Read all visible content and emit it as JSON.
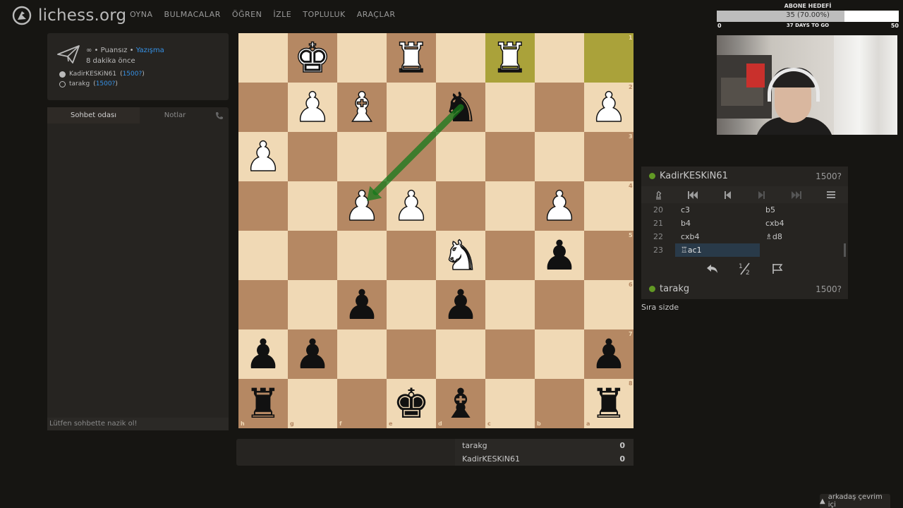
{
  "header": {
    "logo_text": "lichess.org",
    "nav": [
      "OYNA",
      "BULMACALAR",
      "ÖĞREN",
      "İZLE",
      "TOPLULUK",
      "ARAÇLAR"
    ]
  },
  "subscriber_goal": {
    "title": "ABONE HEDEFİ",
    "progress_text": "35 (70.00%)",
    "progress_fraction": 0.7,
    "min": "0",
    "max": "50",
    "days_left": "37 DAYS TO GO"
  },
  "game_info": {
    "line1_prefix": "∞ • Puansız •",
    "line1_link": "Yazışma",
    "line2": "8 dakika önce",
    "white_player": "KadirKESKiN61",
    "white_rating": "1500?",
    "black_player": "tarakg",
    "black_rating": "1500?"
  },
  "chat": {
    "tab_chat": "Sohbet odası",
    "tab_notes": "Notlar",
    "input_placeholder": "Lütfen sohbette nazik ol!"
  },
  "board": {
    "files": [
      "h",
      "g",
      "f",
      "e",
      "d",
      "c",
      "b",
      "a"
    ],
    "ranks": [
      "1",
      "2",
      "3",
      "4",
      "5",
      "6",
      "7",
      "8"
    ],
    "last_move_squares": [
      "c1",
      "a1"
    ],
    "arrow": {
      "from": "d2",
      "to": "f4",
      "color": "#15781b"
    },
    "pieces": [
      {
        "sq": "g1",
        "glyph": "♚",
        "color": "white",
        "name": "white-king"
      },
      {
        "sq": "e1",
        "glyph": "♜",
        "color": "white",
        "name": "white-rook"
      },
      {
        "sq": "c1",
        "glyph": "♜",
        "color": "white",
        "name": "white-rook"
      },
      {
        "sq": "g2",
        "glyph": "♟",
        "color": "white",
        "name": "white-pawn"
      },
      {
        "sq": "f2",
        "glyph": "♝",
        "color": "white",
        "name": "white-bishop"
      },
      {
        "sq": "d2",
        "glyph": "♞",
        "color": "black",
        "name": "black-knight"
      },
      {
        "sq": "a2",
        "glyph": "♟",
        "color": "white",
        "name": "white-pawn"
      },
      {
        "sq": "h3",
        "glyph": "♟",
        "color": "white",
        "name": "white-pawn"
      },
      {
        "sq": "f4",
        "glyph": "♟",
        "color": "white",
        "name": "white-pawn"
      },
      {
        "sq": "e4",
        "glyph": "♟",
        "color": "white",
        "name": "white-pawn"
      },
      {
        "sq": "b4",
        "glyph": "♟",
        "color": "white",
        "name": "white-pawn"
      },
      {
        "sq": "d5",
        "glyph": "♞",
        "color": "white",
        "name": "white-knight"
      },
      {
        "sq": "b5",
        "glyph": "♟",
        "color": "black",
        "name": "black-pawn"
      },
      {
        "sq": "f6",
        "glyph": "♟",
        "color": "black",
        "name": "black-pawn"
      },
      {
        "sq": "d6",
        "glyph": "♟",
        "color": "black",
        "name": "black-pawn"
      },
      {
        "sq": "h7",
        "glyph": "♟",
        "color": "black",
        "name": "black-pawn"
      },
      {
        "sq": "g7",
        "glyph": "♟",
        "color": "black",
        "name": "black-pawn"
      },
      {
        "sq": "a7",
        "glyph": "♟",
        "color": "black",
        "name": "black-pawn"
      },
      {
        "sq": "h8",
        "glyph": "♜",
        "color": "black",
        "name": "black-rook"
      },
      {
        "sq": "e8",
        "glyph": "♚",
        "color": "black",
        "name": "black-king"
      },
      {
        "sq": "d8",
        "glyph": "♝",
        "color": "black",
        "name": "black-bishop"
      },
      {
        "sq": "a8",
        "glyph": "♜",
        "color": "black",
        "name": "black-rook"
      }
    ]
  },
  "move_panel": {
    "opponent_name": "KadirKESKiN61",
    "opponent_rating": "1500?",
    "player_name": "tarakg",
    "player_rating": "1500?",
    "moves": [
      {
        "num": "20",
        "white": "c3",
        "black": "b5"
      },
      {
        "num": "21",
        "white": "b4",
        "black": "cxb4"
      },
      {
        "num": "22",
        "white": "cxb4",
        "black": "♗d8"
      },
      {
        "num": "23",
        "white": "♖ac1",
        "black": ""
      }
    ],
    "active_move_index": 3,
    "status": "Sıra sizde"
  },
  "scores": [
    {
      "name": "tarakg",
      "score": "0"
    },
    {
      "name": "KadirKESKiN61",
      "score": "0"
    }
  ],
  "friends": {
    "label": "arkadaş çevrim içi"
  }
}
